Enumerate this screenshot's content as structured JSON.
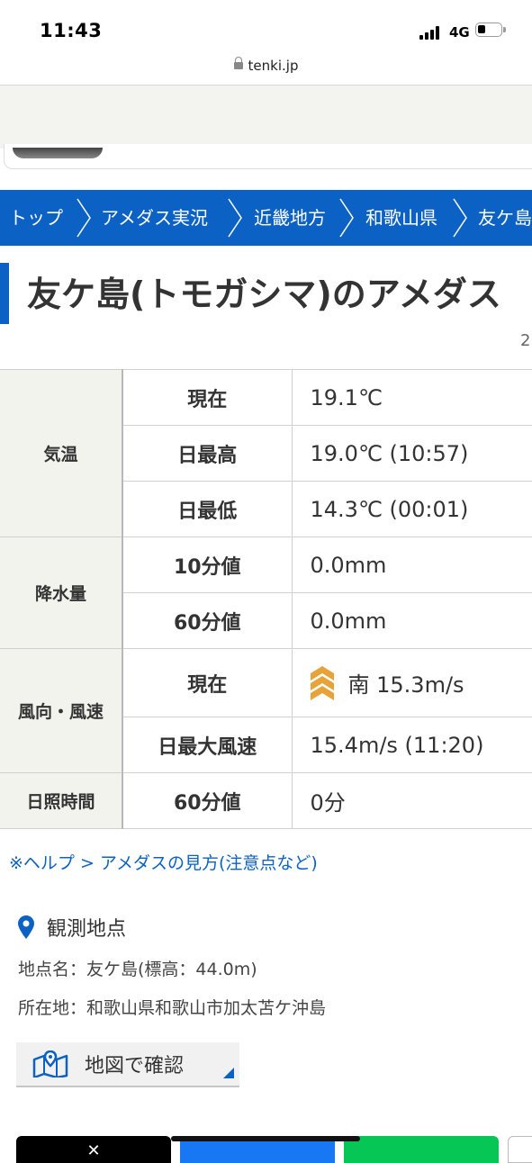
{
  "status_bar": {
    "time": "11:43",
    "network": "4G"
  },
  "browser": {
    "url": "tenki.jp"
  },
  "breadcrumb": {
    "items": [
      {
        "label": "トップ"
      },
      {
        "label": "アメダス実況"
      },
      {
        "label": "近畿地方"
      },
      {
        "label": "和歌山県"
      },
      {
        "label": "友ケ島"
      }
    ]
  },
  "page": {
    "title": "友ケ島(トモガシマ)のアメダス",
    "date_fragment": "2"
  },
  "table": {
    "temperature": {
      "category": "気温",
      "rows": [
        {
          "label": "現在",
          "value": "19.1℃"
        },
        {
          "label": "日最高",
          "value": "19.0℃ (10:57)"
        },
        {
          "label": "日最低",
          "value": "14.3℃ (00:01)"
        }
      ]
    },
    "precipitation": {
      "category": "降水量",
      "rows": [
        {
          "label": "10分値",
          "value": "0.0mm"
        },
        {
          "label": "60分値",
          "value": "0.0mm"
        }
      ]
    },
    "wind": {
      "category": "風向・風速",
      "rows": [
        {
          "label": "現在",
          "value": "南 15.3m/s",
          "icon": "wind-direction-south-icon",
          "icon_color": "#e8a23a"
        },
        {
          "label": "日最大風速",
          "value": "15.4m/s (11:20)"
        }
      ]
    },
    "sunshine": {
      "category": "日照時間",
      "rows": [
        {
          "label": "60分値",
          "value": "0分"
        }
      ]
    }
  },
  "help_link": "※ヘルプ > アメダスの見方(注意点など)",
  "observation": {
    "title": "観測地点",
    "name_line": "地点名：友ケ島(標高：44.0m)",
    "address_line": "所在地：和歌山県和歌山市加太苫ケ沖島",
    "map_button_label": "地図で確認"
  },
  "colors": {
    "brand_blue": "#0b62c4",
    "x_black": "#000000",
    "facebook_blue": "#1877f2",
    "line_green": "#06c755"
  }
}
